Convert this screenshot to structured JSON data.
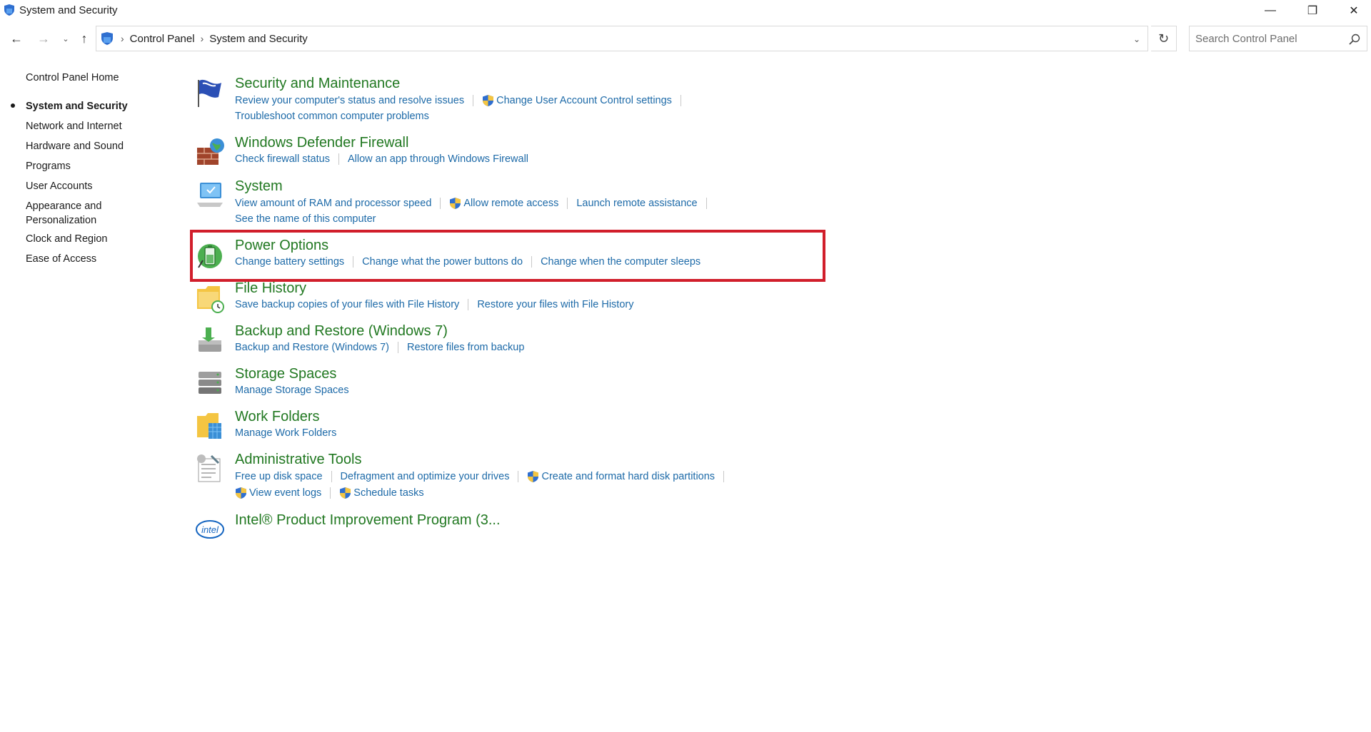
{
  "window": {
    "title": "System and Security",
    "minimize_glyph": "—",
    "maximize_glyph": "❐",
    "close_glyph": "✕"
  },
  "nav": {
    "back_glyph": "←",
    "forward_glyph": "→",
    "recent_glyph": "⌄",
    "up_glyph": "↑",
    "refresh_glyph": "↻",
    "breadcrumbs": [
      "Control Panel",
      "System and Security"
    ],
    "breadcrumb_separator": "›",
    "dropdown_glyph": "⌄",
    "search_placeholder": "Search Control Panel"
  },
  "sidebar": {
    "items": [
      {
        "label": "Control Panel Home",
        "active": false
      },
      {
        "label": "System and Security",
        "active": true
      },
      {
        "label": "Network and Internet",
        "active": false
      },
      {
        "label": "Hardware and Sound",
        "active": false
      },
      {
        "label": "Programs",
        "active": false
      },
      {
        "label": "User Accounts",
        "active": false
      },
      {
        "label": "Appearance and Personalization",
        "active": false
      },
      {
        "label": "Clock and Region",
        "active": false
      },
      {
        "label": "Ease of Access",
        "active": false
      }
    ]
  },
  "categories": [
    {
      "title": "Security and Maintenance",
      "icon": "flag-icon",
      "rows": [
        [
          {
            "label": "Review your computer's status and resolve issues",
            "shield": false
          },
          {
            "label": "Change User Account Control settings",
            "shield": true
          }
        ],
        [
          {
            "label": "Troubleshoot common computer problems",
            "shield": false
          }
        ]
      ]
    },
    {
      "title": "Windows Defender Firewall",
      "icon": "firewall-icon",
      "rows": [
        [
          {
            "label": "Check firewall status",
            "shield": false
          },
          {
            "label": "Allow an app through Windows Firewall",
            "shield": false
          }
        ]
      ]
    },
    {
      "title": "System",
      "icon": "computer-icon",
      "rows": [
        [
          {
            "label": "View amount of RAM and processor speed",
            "shield": false
          },
          {
            "label": "Allow remote access",
            "shield": true
          },
          {
            "label": "Launch remote assistance",
            "shield": false
          }
        ],
        [
          {
            "label": "See the name of this computer",
            "shield": false
          }
        ]
      ]
    },
    {
      "title": "Power Options",
      "icon": "battery-icon",
      "rows": [
        [
          {
            "label": "Change battery settings",
            "shield": false
          },
          {
            "label": "Change what the power buttons do",
            "shield": false
          },
          {
            "label": "Change when the computer sleeps",
            "shield": false
          }
        ]
      ]
    },
    {
      "title": "File History",
      "icon": "file-history-icon",
      "rows": [
        [
          {
            "label": "Save backup copies of your files with File History",
            "shield": false
          },
          {
            "label": "Restore your files with File History",
            "shield": false
          }
        ]
      ]
    },
    {
      "title": "Backup and Restore (Windows 7)",
      "icon": "backup-icon",
      "rows": [
        [
          {
            "label": "Backup and Restore (Windows 7)",
            "shield": false
          },
          {
            "label": "Restore files from backup",
            "shield": false
          }
        ]
      ]
    },
    {
      "title": "Storage Spaces",
      "icon": "storage-icon",
      "rows": [
        [
          {
            "label": "Manage Storage Spaces",
            "shield": false
          }
        ]
      ]
    },
    {
      "title": "Work Folders",
      "icon": "work-folders-icon",
      "rows": [
        [
          {
            "label": "Manage Work Folders",
            "shield": false
          }
        ]
      ]
    },
    {
      "title": "Administrative Tools",
      "icon": "admin-tools-icon",
      "rows": [
        [
          {
            "label": "Free up disk space",
            "shield": false
          },
          {
            "label": "Defragment and optimize your drives",
            "shield": false
          },
          {
            "label": "Create and format hard disk partitions",
            "shield": true
          }
        ],
        [
          {
            "label": "View event logs",
            "shield": true
          },
          {
            "label": "Schedule tasks",
            "shield": true
          }
        ]
      ]
    },
    {
      "title": "Intel® Product Improvement Program (3...",
      "icon": "intel-icon",
      "rows": []
    }
  ],
  "colors": {
    "category_title": "#217821",
    "link": "#1d6aa8",
    "highlight_border": "#d11e2b"
  }
}
